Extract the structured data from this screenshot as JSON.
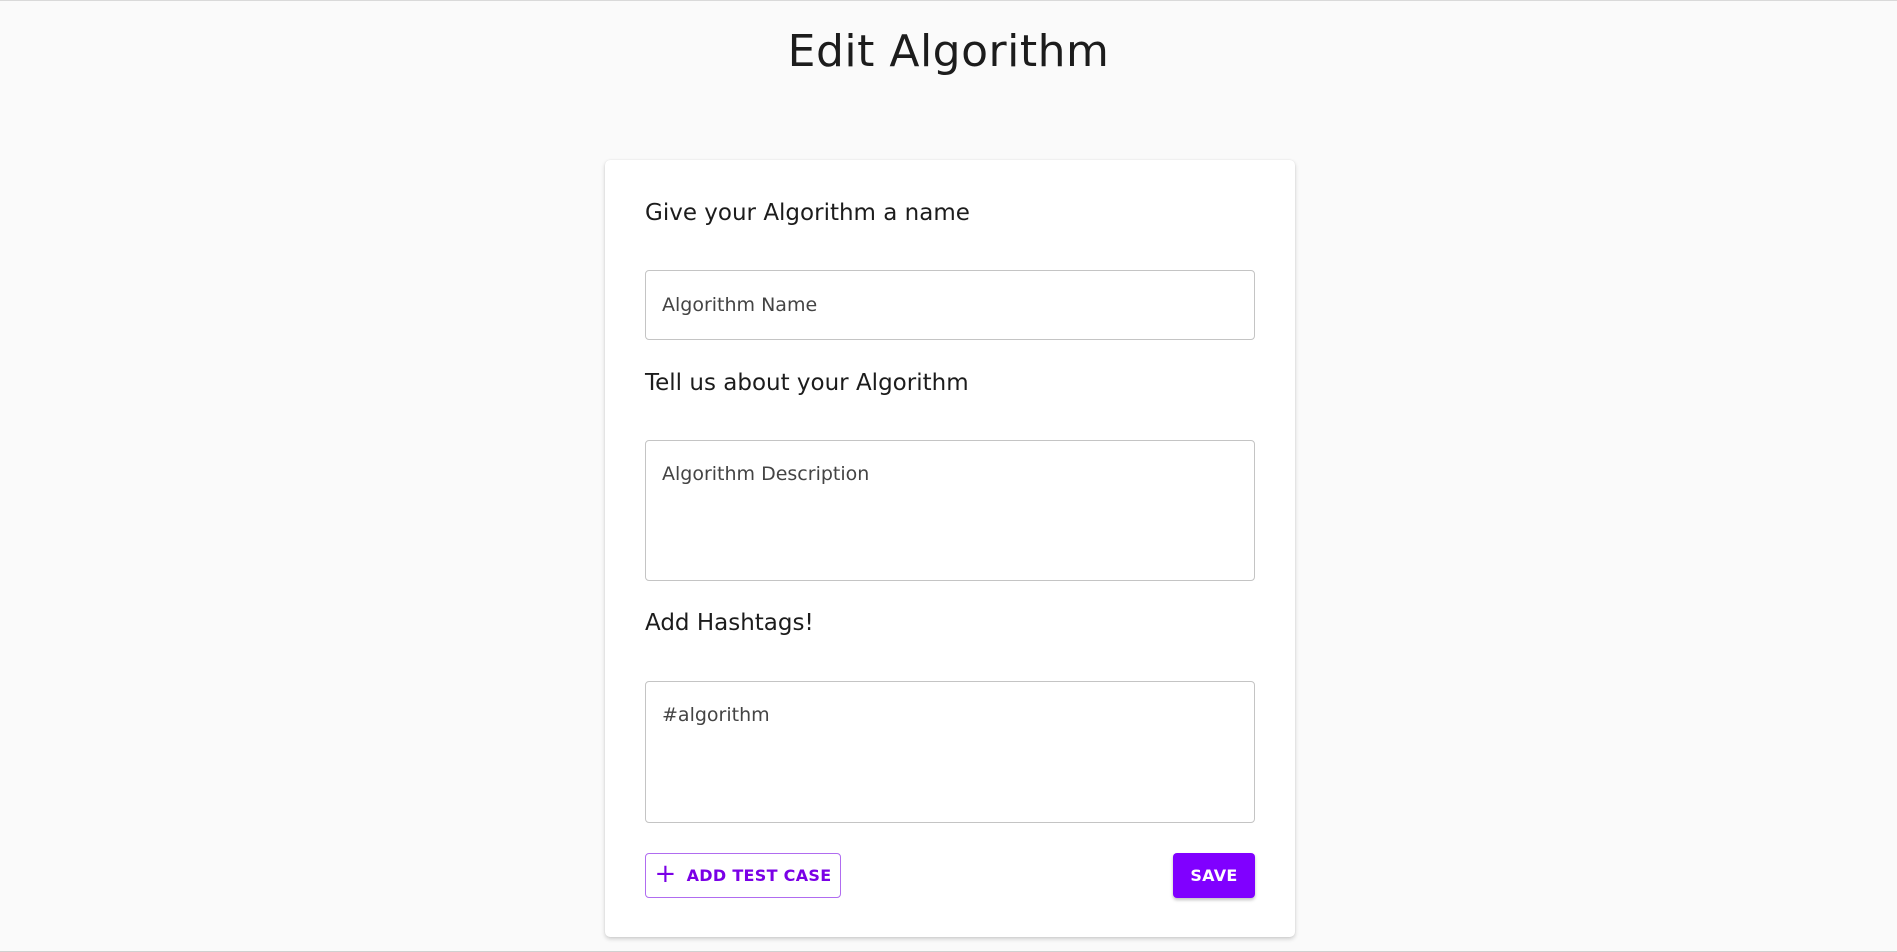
{
  "page": {
    "title": "Edit Algorithm"
  },
  "form": {
    "name_section_label": "Give your Algorithm a name",
    "name_placeholder": "Algorithm Name",
    "name_value": "",
    "description_section_label": "Tell us about your Algorithm",
    "description_placeholder": "Algorithm Description",
    "description_value": "",
    "hashtags_section_label": "Add Hashtags!",
    "hashtags_placeholder": "#algorithm",
    "hashtags_value": ""
  },
  "actions": {
    "add_test_case_label": "ADD TEST CASE",
    "add_test_case_icon": "plus-icon",
    "save_label": "SAVE"
  },
  "colors": {
    "accent": "#8000ff",
    "background": "#fafafa",
    "card": "#ffffff"
  }
}
